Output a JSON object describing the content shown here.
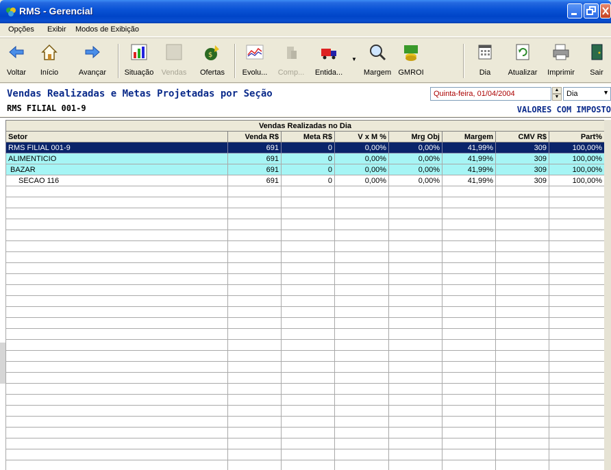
{
  "window": {
    "title": "RMS - Gerencial"
  },
  "menu": {
    "items": [
      "Opções",
      "Exibir",
      "Modos de Exibição"
    ]
  },
  "toolbar": {
    "buttons": [
      {
        "label": "Voltar",
        "icon": "arrow-left-icon"
      },
      {
        "label": "Início",
        "icon": "home-icon"
      },
      {
        "label": "Avançar",
        "icon": "arrow-right-icon"
      },
      {
        "label": "Situação",
        "icon": "situation-chart-icon"
      },
      {
        "label": "Vendas",
        "icon": "sales-icon",
        "disabled": true
      },
      {
        "label": "Ofertas",
        "icon": "offers-icon"
      },
      {
        "label": "Evolu...",
        "icon": "evolution-chart-icon"
      },
      {
        "label": "Comp...",
        "icon": "compare-icon",
        "disabled": true
      },
      {
        "label": "Entida...",
        "icon": "truck-icon"
      },
      {
        "label": "Margem",
        "icon": "magnifier-icon"
      },
      {
        "label": "GMROI",
        "icon": "money-icon"
      },
      {
        "label": "Dia",
        "icon": "calendar-icon"
      },
      {
        "label": "Atualizar",
        "icon": "refresh-icon"
      },
      {
        "label": "Imprimir",
        "icon": "printer-icon"
      },
      {
        "label": "Sair",
        "icon": "exit-door-icon"
      }
    ]
  },
  "header": {
    "title": "Vendas Realizadas e Metas Projetadas por Seção",
    "branch": "RMS FILIAL 001-9",
    "date": "Quinta-feira, 01/04/2004",
    "period": "Dia",
    "tax_label": "VALORES COM IMPOSTO"
  },
  "grid": {
    "group_header": "Vendas Realizadas no Dia",
    "columns": [
      "Setor",
      "Venda R$",
      "Meta R$",
      "V x M %",
      "Mrg Obj",
      "Margem",
      "CMV R$",
      "Part%"
    ],
    "rows": [
      {
        "level": 0,
        "style": "selected",
        "cells": [
          "RMS FILIAL 001-9",
          "691",
          "0",
          "0,00%",
          "0,00%",
          "41,99%",
          "309",
          "100,00%"
        ]
      },
      {
        "level": 0,
        "style": "cyan",
        "cells": [
          "ALIMENTICIO",
          "691",
          "0",
          "0,00%",
          "0,00%",
          "41,99%",
          "309",
          "100,00%"
        ]
      },
      {
        "level": 1,
        "style": "cyan",
        "cells": [
          "BAZAR",
          "691",
          "0",
          "0,00%",
          "0,00%",
          "41,99%",
          "309",
          "100,00%"
        ]
      },
      {
        "level": 2,
        "style": "normal",
        "cells": [
          "SECAO 116",
          "691",
          "0",
          "0,00%",
          "0,00%",
          "41,99%",
          "309",
          "100,00%"
        ]
      }
    ]
  },
  "colors": {
    "title_blue": "#0a2a8a",
    "selected_row": "#0a246a",
    "highlight_row": "#a6f5f5",
    "date_text": "#aa0000"
  }
}
